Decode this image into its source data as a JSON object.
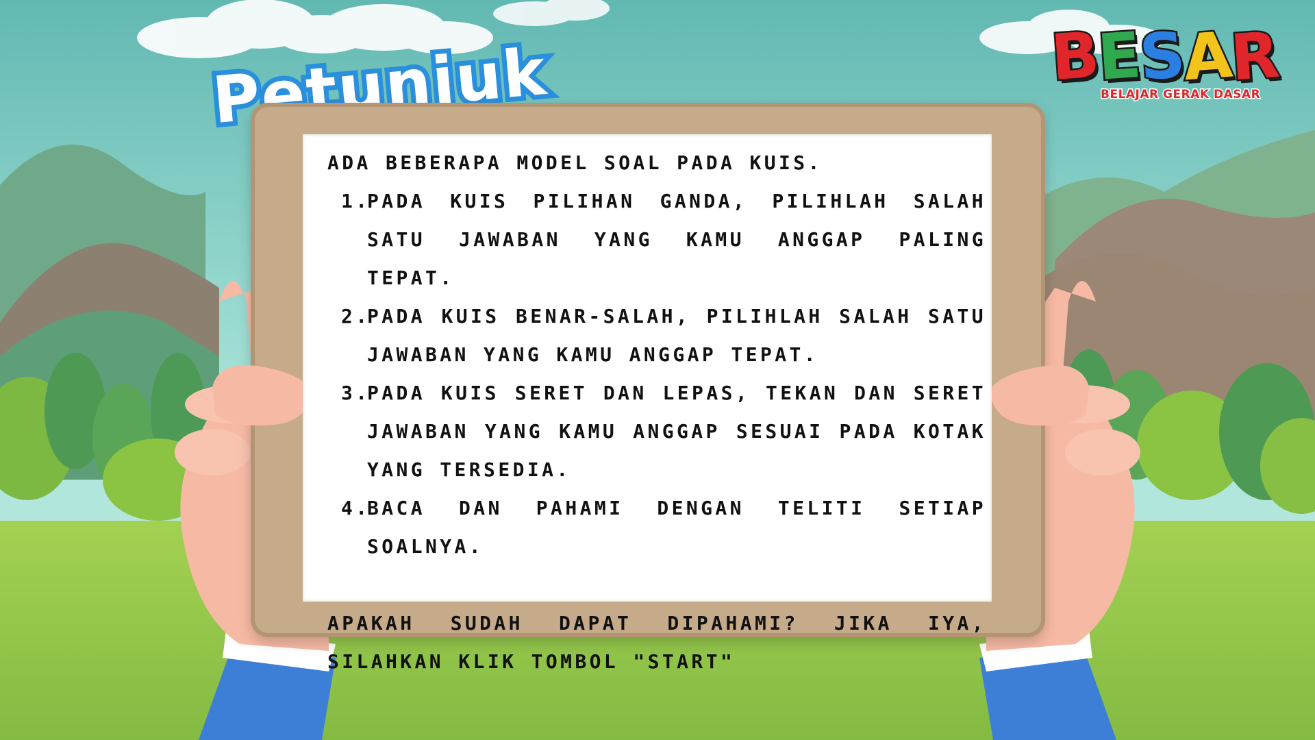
{
  "header": {
    "title": "Petunjuk"
  },
  "logo": {
    "letters": [
      "B",
      "E",
      "S",
      "A",
      "R"
    ],
    "letter_colors": [
      "#e0262a",
      "#2fa84f",
      "#2a7fe0",
      "#f2c41b",
      "#e0262a"
    ],
    "subtitle": "BELAJAR GERAK DASAR"
  },
  "instructions": {
    "intro": "ADA BEBERAPA MODEL SOAL PADA KUIS.",
    "items": [
      {
        "number": "1.",
        "text": "PADA KUIS PILIHAN GANDA, PILIHLAH SALAH SATU JAWABAN YANG KAMU ANGGAP PALING TEPAT."
      },
      {
        "number": "2.",
        "text": "PADA KUIS BENAR-SALAH, PILIHLAH SALAH SATU JAWABAN YANG KAMU ANGGAP TEPAT."
      },
      {
        "number": "3.",
        "text": "PADA KUIS SERET DAN LEPAS, TEKAN DAN SERET JAWABAN YANG KAMU ANGGAP SESUAI PADA KOTAK YANG TERSEDIA."
      },
      {
        "number": "4.",
        "text": "BACA DAN PAHAMI DENGAN TELITI SETIAP SOALNYA."
      }
    ],
    "closing": "APAKAH SUDAH DAPAT DIPAHAMI? JIKA IYA, SILAHKAN KLIK TOMBOL \"START\""
  },
  "colors": {
    "sky": "#8fd6cf",
    "grass": "#8dc24a",
    "board_frame": "#c6ab8b",
    "title_outline": "#2a8fdc",
    "sleeve": "#3d7fd6"
  }
}
